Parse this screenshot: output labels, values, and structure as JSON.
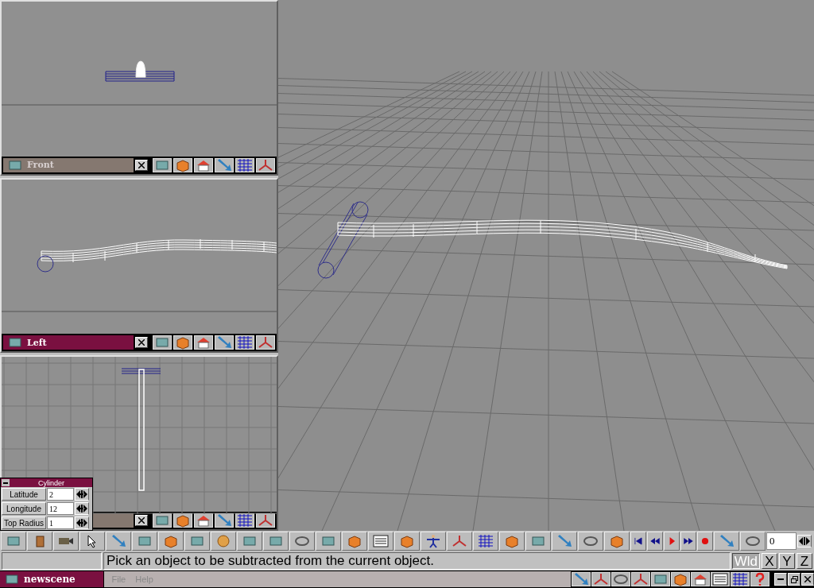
{
  "viewports": [
    {
      "title": "Front",
      "selected": false
    },
    {
      "title": "Left",
      "selected": true
    },
    {
      "selected": false
    }
  ],
  "panel": {
    "title": "Cylinder",
    "fields": [
      {
        "label": "Latitude",
        "value": "2"
      },
      {
        "label": "Longitude",
        "value": "12"
      },
      {
        "label": "Top Radius",
        "value": "1"
      }
    ]
  },
  "frame": {
    "value": "0"
  },
  "status": "Pick an object to be subtracted from the current object.",
  "axes": [
    {
      "label": "Wld",
      "selected": true
    },
    {
      "label": "X",
      "selected": false
    },
    {
      "label": "Y",
      "selected": false
    },
    {
      "label": "Z",
      "selected": false
    }
  ],
  "taskbar": {
    "app": "newscene",
    "menus": [
      {
        "label": "File",
        "disabled": true
      },
      {
        "label": "Help",
        "disabled": true
      }
    ]
  }
}
